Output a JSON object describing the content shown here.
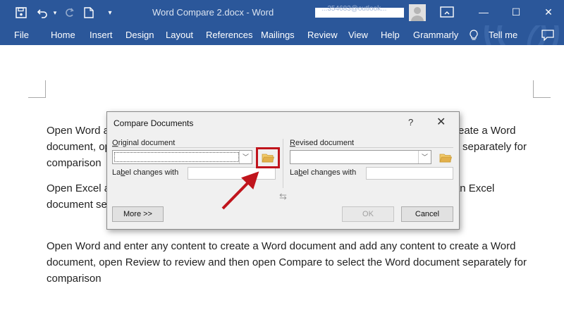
{
  "titlebar": {
    "document_title": "Word Compare 2.docx  -  Word",
    "user_text": "...354683@outlook..."
  },
  "menu": {
    "items": [
      "File",
      "Home",
      "Insert",
      "Design",
      "Layout",
      "References",
      "Mailings",
      "Review",
      "View",
      "Help",
      "Grammarly",
      "Tell me"
    ]
  },
  "document": {
    "paragraphs": [
      "Open Word and enter any content to create a Word document and add any content to create a Word document, open Review to review and then open Compare to select the Word document separately for comparison",
      "Open Excel and enter any text to create an Excel document and add any text to create an Excel document separately for comparison",
      "Open Word and enter any content to create a Word document and add any content to create a Word document, open Review to review and then open Compare to select the Word document separately for comparison"
    ]
  },
  "dialog": {
    "title": "Compare Documents",
    "help": "?",
    "close": "✕",
    "original_label_prefix": "O",
    "original_label_rest": "riginal document",
    "revised_label_prefix": "R",
    "revised_label_rest": "evised document",
    "label_changes_a": "La",
    "label_changes_b": "b",
    "label_changes_c": "el changes with",
    "label_changes_r_a": "La",
    "label_changes_r_b": "b",
    "label_changes_r_c": "el changes with",
    "swap": "⇆",
    "more_button": "More >>",
    "ok_button": "OK",
    "cancel_button": "Cancel",
    "original_value": "",
    "revised_value": ""
  },
  "icons": {
    "save": "save-icon",
    "undo": "undo-icon",
    "redo": "redo-icon",
    "new": "new-document-icon",
    "folder": "folder-open-icon"
  },
  "colors": {
    "ribbon": "#2b579a",
    "highlight": "#c0141c",
    "folder": "#e3b04b"
  }
}
